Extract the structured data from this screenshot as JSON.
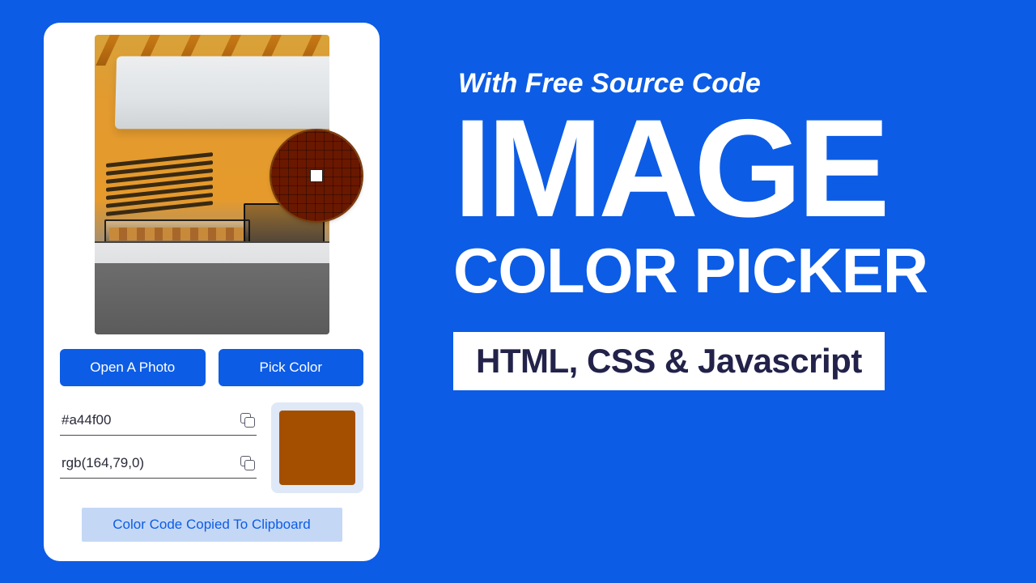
{
  "picker": {
    "open_photo_label": "Open A Photo",
    "pick_color_label": "Pick Color",
    "hex_value": "#a44f00",
    "rgb_value": "rgb(164,79,0)",
    "swatch_color": "#a44f00",
    "toast": "Color Code Copied To Clipboard"
  },
  "hero": {
    "tagline": "With Free Source Code",
    "title": "IMAGE",
    "subtitle": "COLOR PICKER",
    "tech": "HTML, CSS & Javascript"
  }
}
